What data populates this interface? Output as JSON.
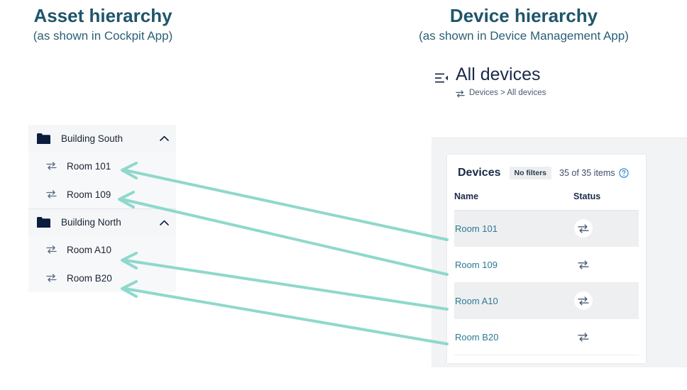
{
  "titles": {
    "left_main": "Asset hierarchy",
    "left_sub": "(as shown in Cockpit App)",
    "right_main": "Device hierarchy",
    "right_sub": "(as shown in Device Management App)"
  },
  "asset_hierarchy": {
    "groups": [
      {
        "label": "Building South",
        "icon": "folder-icon",
        "chevron": "chevron-up-icon",
        "children": [
          {
            "label": "Room 101",
            "icon": "device-exchange-icon"
          },
          {
            "label": "Room 109",
            "icon": "device-exchange-icon"
          }
        ]
      },
      {
        "label": "Building North",
        "icon": "folder-icon",
        "chevron": "chevron-up-icon",
        "children": [
          {
            "label": "Room A10",
            "icon": "device-exchange-icon"
          },
          {
            "label": "Room B20",
            "icon": "device-exchange-icon"
          }
        ]
      }
    ]
  },
  "device_app": {
    "header": {
      "icon": "device-list-icon",
      "title": "All devices",
      "breadcrumb_icon": "device-exchange-icon",
      "breadcrumb": "Devices > All devices"
    },
    "card": {
      "title": "Devices",
      "filter_badge": "No filters",
      "item_count": "35 of 35 items",
      "help_icon": "help-circle-icon",
      "columns": [
        "Name",
        "Status"
      ],
      "rows": [
        {
          "name": "Room 101",
          "status_icon": "device-exchange-icon",
          "shaded": true
        },
        {
          "name": "Room 109",
          "status_icon": "device-exchange-icon",
          "shaded": false
        },
        {
          "name": "Room A10",
          "status_icon": "device-exchange-icon",
          "shaded": true
        },
        {
          "name": "Room B20",
          "status_icon": "device-exchange-icon",
          "shaded": false
        }
      ]
    }
  },
  "connectors": {
    "color": "#8fd8cc",
    "mappings": [
      {
        "from": "Room 101",
        "to": "Room 101"
      },
      {
        "from": "Room 109",
        "to": "Room 109"
      },
      {
        "from": "Room A10",
        "to": "Room A10"
      },
      {
        "from": "Room B20",
        "to": "Room B20"
      }
    ]
  },
  "colors": {
    "title": "#1f556b",
    "accent_arrow": "#8fd8cc",
    "link": "#2c7a93",
    "dark_navy": "#1b2a49"
  }
}
